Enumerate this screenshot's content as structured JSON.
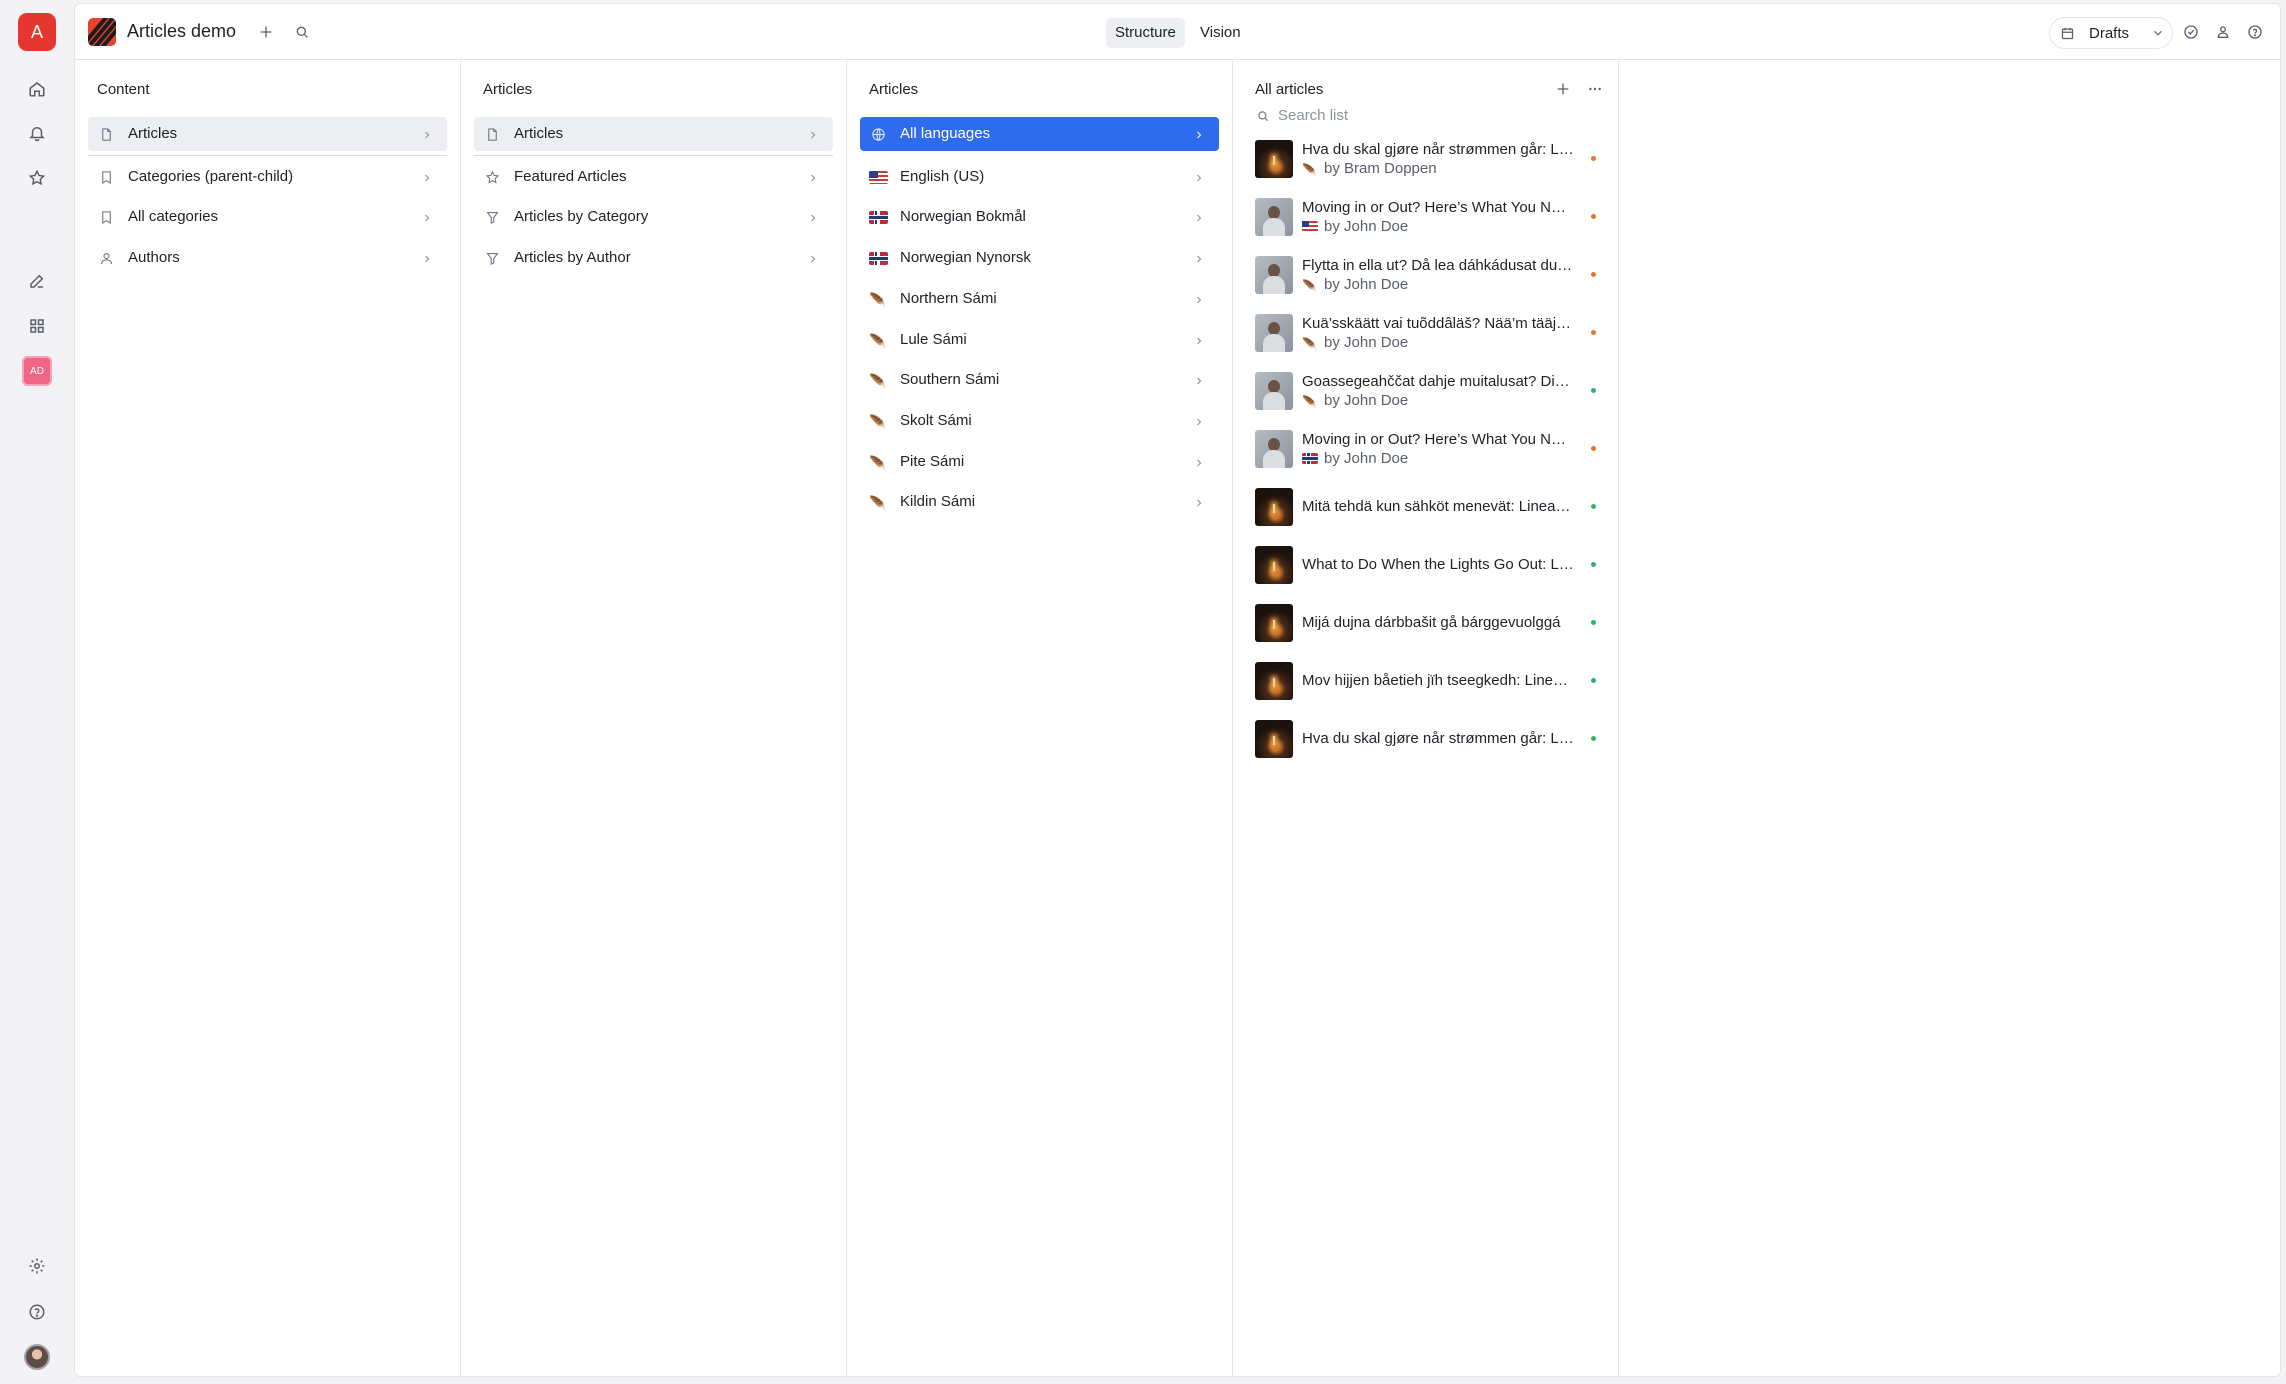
{
  "rail": {
    "org_letter": "A",
    "workspace_badge": "AD"
  },
  "topbar": {
    "project_title": "Articles demo",
    "tabs": [
      "Structure",
      "Vision"
    ],
    "active_tab": "Structure",
    "perspective": "Drafts"
  },
  "pane_content": {
    "title": "Content",
    "items": [
      {
        "label": "Articles",
        "icon": "document-icon",
        "selected": true
      },
      {
        "label": "Categories (parent-child)",
        "icon": "bookmark-icon"
      },
      {
        "label": "All categories",
        "icon": "bookmark-icon"
      },
      {
        "label": "Authors",
        "icon": "user-icon"
      }
    ]
  },
  "pane_articles": {
    "title": "Articles",
    "items": [
      {
        "label": "Articles",
        "icon": "document-icon",
        "selected": true
      },
      {
        "label": "Featured Articles",
        "icon": "star-icon"
      },
      {
        "label": "Articles by Category",
        "icon": "filter-icon"
      },
      {
        "label": "Articles by Author",
        "icon": "filter-icon"
      }
    ]
  },
  "pane_languages": {
    "title": "Articles",
    "items": [
      {
        "label": "All languages",
        "icon": "globe-icon",
        "selected": true
      },
      {
        "label": "English (US)",
        "icon": "us-flag-icon"
      },
      {
        "label": "Norwegian Bokmål",
        "icon": "norway-flag-icon"
      },
      {
        "label": "Norwegian Nynorsk",
        "icon": "norway-flag-icon"
      },
      {
        "label": "Northern Sámi",
        "icon": "feather-icon"
      },
      {
        "label": "Lule Sámi",
        "icon": "feather-icon"
      },
      {
        "label": "Southern Sámi",
        "icon": "feather-icon"
      },
      {
        "label": "Skolt Sámi",
        "icon": "feather-icon"
      },
      {
        "label": "Pite Sámi",
        "icon": "feather-icon"
      },
      {
        "label": "Kildin Sámi",
        "icon": "feather-icon"
      }
    ]
  },
  "pane_documents": {
    "title": "All articles",
    "search_placeholder": "Search list",
    "items": [
      {
        "title": "Hva du skal gjøre når strømmen går: Lineart...",
        "subtitle": "by Bram Doppen",
        "lang_icon": "feather",
        "thumb": "dark",
        "status": "orange"
      },
      {
        "title": "Moving in or Out? Here’s What You Need to Know",
        "subtitle": "by John Doe",
        "lang_icon": "us",
        "thumb": "person",
        "status": "orange"
      },
      {
        "title": "Flytta in ella ut? Då lea dáhkádusat dušši",
        "subtitle": "by John Doe",
        "lang_icon": "feather",
        "thumb": "person",
        "status": "orange"
      },
      {
        "title": "Kuä’sskäätt vai tuõddâläš? Nää’m tääjjad",
        "subtitle": "by John Doe",
        "lang_icon": "feather",
        "thumb": "person",
        "status": "orange"
      },
      {
        "title": "Goassegeahččat dahje muitalusat? Dieđut",
        "subtitle": "by John Doe",
        "lang_icon": "feather",
        "thumb": "person",
        "status": "green"
      },
      {
        "title": "Moving in or Out? Here’s What You Need to Know",
        "subtitle": "by John Doe",
        "lang_icon": "no",
        "thumb": "person",
        "status": "orange"
      },
      {
        "title": "Mitä tehdä kun sähköt menevät: Lineaarinen",
        "subtitle": "",
        "lang_icon": "",
        "thumb": "dark",
        "status": "green"
      },
      {
        "title": "What to Do When the Lights Go Out: Linear",
        "subtitle": "",
        "lang_icon": "",
        "thumb": "dark",
        "status": "green"
      },
      {
        "title": "Mijá dujna dárbbašit gå bárggevuolggá",
        "subtitle": "",
        "lang_icon": "",
        "thumb": "dark",
        "status": "green"
      },
      {
        "title": "Mov hijjen båetieh jïh tseegkedh: Lineaarinen",
        "subtitle": "",
        "lang_icon": "",
        "thumb": "dark",
        "status": "green"
      },
      {
        "title": "Hva du skal gjøre når strømmen går: Lineart",
        "subtitle": "",
        "lang_icon": "",
        "thumb": "dark",
        "status": "green"
      }
    ]
  },
  "colors": {
    "accent": "#2f6bed",
    "brand": "#e5362f",
    "status_changed": "#e4772a",
    "status_published": "#2fb26a"
  }
}
